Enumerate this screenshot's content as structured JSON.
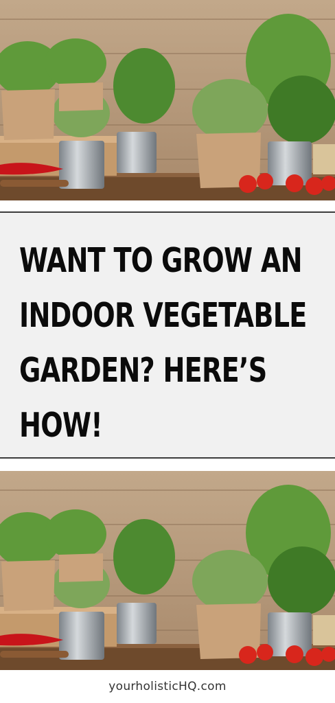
{
  "headline": "WANT TO GROW AN INDOOR VEGETABLE GARDEN? HERE’S HOW!",
  "photo": {
    "subject": "herb-pots-on-wooden-shelf",
    "colors": {
      "wood_wall": "#b59a7c",
      "wood_dark": "#8a6b4d",
      "shelf": "#6e4a2c",
      "leaf": "#5f9a3a",
      "leaf_dark": "#3f7a26",
      "metal": "#9aa0a6",
      "paper": "#c9a27a",
      "tomato": "#d8261c",
      "pepper": "#c8141a"
    }
  },
  "footer": {
    "site": "yourholisticHQ.com"
  },
  "colors": {
    "panel_bg": "#f1f1f1",
    "rule": "#3b3b3b",
    "text": "#0b0b0b"
  }
}
